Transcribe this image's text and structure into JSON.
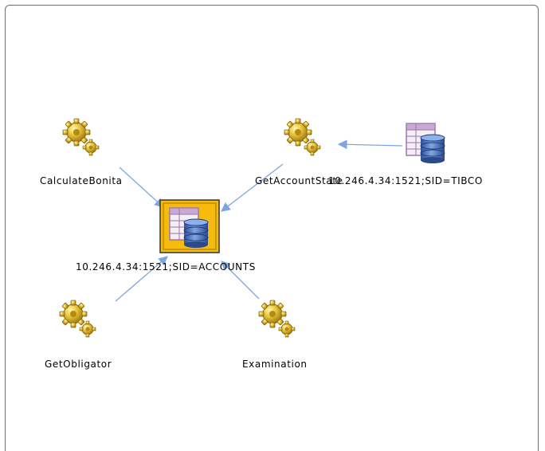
{
  "diagram": {
    "nodes": [
      {
        "id": "calc",
        "kind": "process",
        "label": "CalculateBonita",
        "icon": "process-gears-icon"
      },
      {
        "id": "getacct",
        "kind": "process",
        "label": "GetAccountState",
        "icon": "process-gears-icon"
      },
      {
        "id": "tibco",
        "kind": "database",
        "label": "10.246.4.34:1521;SID=TIBCO",
        "icon": "database-table-icon"
      },
      {
        "id": "accounts",
        "kind": "database",
        "label": "10.246.4.34:1521;SID=ACCOUNTS",
        "icon": "database-table-icon",
        "selected": true
      },
      {
        "id": "getobl",
        "kind": "process",
        "label": "GetObligator",
        "icon": "process-gears-icon"
      },
      {
        "id": "exam",
        "kind": "process",
        "label": "Examination",
        "icon": "process-gears-icon"
      }
    ],
    "edges": [
      {
        "from": "calc",
        "to": "accounts"
      },
      {
        "from": "getacct",
        "to": "accounts"
      },
      {
        "from": "getobl",
        "to": "accounts"
      },
      {
        "from": "exam",
        "to": "accounts"
      },
      {
        "from": "tibco",
        "to": "getacct"
      }
    ],
    "colors": {
      "edge": "#7ea6dc",
      "gear_light": "#f2d84a",
      "gear_dark": "#a67f10",
      "selection_fill": "#f7bb10",
      "db_blue": "#3c68b8",
      "table_purple": "#9b76a8"
    }
  }
}
